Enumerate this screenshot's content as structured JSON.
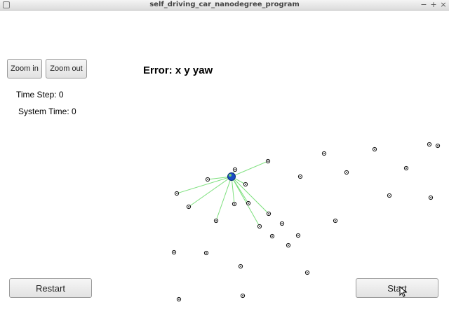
{
  "window": {
    "title": "self_driving_car_nanodegree_program",
    "controls": [
      "−",
      "+",
      "×"
    ]
  },
  "toolbar": {
    "zoom_in_label": "Zoom in",
    "zoom_out_label": "Zoom out"
  },
  "status": {
    "error_label": "Error: x y yaw",
    "time_step": "Time Step: 0",
    "system_time": "System Time: 0"
  },
  "buttons": {
    "restart_label": "Restart",
    "start_label": "Start"
  },
  "colors": {
    "observation_line": "#7de07d",
    "car": "#1a4fc4",
    "landmark_stroke": "#111111"
  }
}
